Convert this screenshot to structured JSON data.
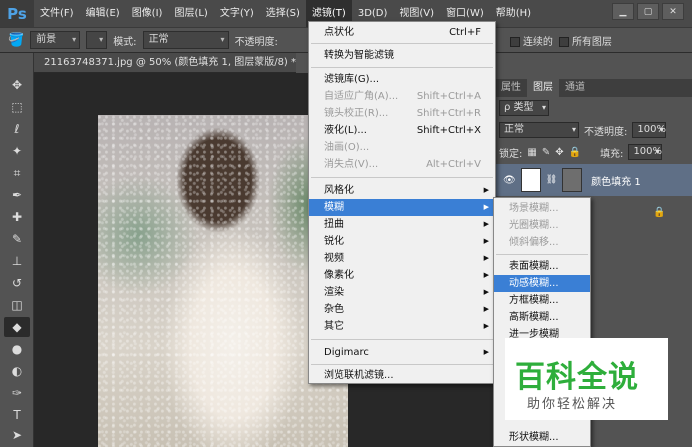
{
  "menubar": {
    "logo": "Ps",
    "items": [
      "文件(F)",
      "编辑(E)",
      "图像(I)",
      "图层(L)",
      "文字(Y)",
      "选择(S)",
      "滤镜(T)",
      "3D(D)",
      "视图(V)",
      "窗口(W)",
      "帮助(H)"
    ],
    "active_index": 6
  },
  "window_controls": [
    "▁",
    "▢",
    "✕"
  ],
  "options_bar": {
    "fill_select": "前景",
    "mode_label": "模式:",
    "mode_value": "正常",
    "opacity_label": "不透明度:",
    "contiguous_label": "连续的",
    "all_layers_label": "所有图层"
  },
  "document_tab": {
    "title": "21163748371.jpg @ 50% (颜色填充 1, 图层蒙版/8) *",
    "close": "×"
  },
  "filter_menu": {
    "items": [
      {
        "label": "点状化",
        "shortcut": "Ctrl+F",
        "state": "normal"
      },
      {
        "label": "转换为智能滤镜",
        "state": "normal"
      },
      {
        "label": "滤镜库(G)...",
        "state": "normal"
      },
      {
        "label": "自适应广角(A)...",
        "shortcut": "Shift+Ctrl+A",
        "state": "disabled"
      },
      {
        "label": "镜头校正(R)...",
        "shortcut": "Shift+Ctrl+R",
        "state": "disabled"
      },
      {
        "label": "液化(L)...",
        "shortcut": "Shift+Ctrl+X",
        "state": "normal"
      },
      {
        "label": "油画(O)...",
        "state": "disabled"
      },
      {
        "label": "消失点(V)...",
        "shortcut": "Alt+Ctrl+V",
        "state": "disabled"
      },
      {
        "label": "风格化",
        "submenu": true,
        "state": "normal"
      },
      {
        "label": "模糊",
        "submenu": true,
        "state": "highlight"
      },
      {
        "label": "扭曲",
        "submenu": true,
        "state": "normal"
      },
      {
        "label": "锐化",
        "submenu": true,
        "state": "normal"
      },
      {
        "label": "视频",
        "submenu": true,
        "state": "normal"
      },
      {
        "label": "像素化",
        "submenu": true,
        "state": "normal"
      },
      {
        "label": "渲染",
        "submenu": true,
        "state": "normal"
      },
      {
        "label": "杂色",
        "submenu": true,
        "state": "normal"
      },
      {
        "label": "其它",
        "submenu": true,
        "state": "normal"
      },
      {
        "label": "Digimarc",
        "submenu": true,
        "state": "normal"
      },
      {
        "label": "浏览联机滤镜...",
        "state": "normal"
      }
    ]
  },
  "blur_submenu": {
    "items": [
      {
        "label": "场景模糊...",
        "state": "disabled"
      },
      {
        "label": "光圈模糊...",
        "state": "disabled"
      },
      {
        "label": "倾斜偏移...",
        "state": "disabled"
      },
      {
        "label": "表面模糊...",
        "state": "normal"
      },
      {
        "label": "动感模糊...",
        "state": "highlight"
      },
      {
        "label": "方框模糊...",
        "state": "normal"
      },
      {
        "label": "高斯模糊...",
        "state": "normal"
      },
      {
        "label": "进一步模糊",
        "state": "normal"
      },
      {
        "label": "形状模糊...",
        "state": "normal"
      }
    ]
  },
  "layers_panel": {
    "tabs": [
      "属性",
      "图层",
      "通道"
    ],
    "filter_label": "ρ 类型",
    "blend_mode": "正常",
    "opacity_label": "不透明度:",
    "opacity_value": "100%",
    "lock_label": "锁定:",
    "fill_label": "填充:",
    "fill_value": "100%",
    "layer_name": "颜色填充 1"
  },
  "watermark": {
    "main": "百科全说",
    "sub": "助你轻松解决",
    "color": "#2eae3b"
  },
  "colors": {
    "menu_highlight": "#3a7fd5",
    "logo": "#4ea2e6",
    "layer_selected": "#5f6f86"
  }
}
